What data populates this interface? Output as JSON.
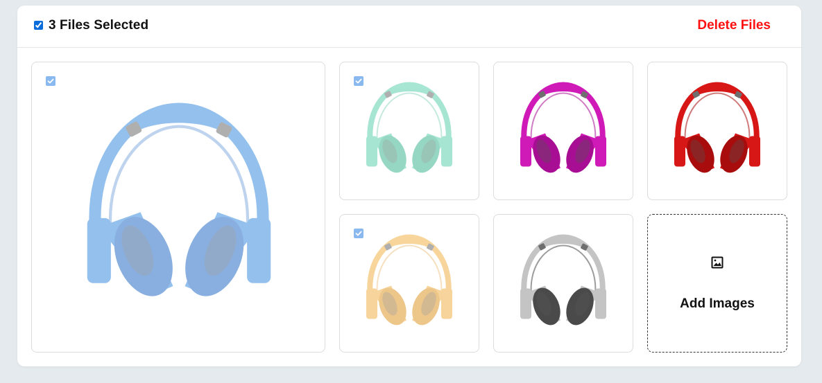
{
  "header": {
    "selected_text": "3 Files Selected",
    "select_all_checked": true,
    "delete_label": "Delete Files"
  },
  "colors": {
    "accent": "#0a6cdc",
    "delete": "#ff1010",
    "checkbox_faded": "#8ab9ef"
  },
  "images": [
    {
      "name": "blue-headphones",
      "color": "#3d8de0",
      "dark": "#2a6fc8",
      "selected": true
    },
    {
      "name": "green-headphones",
      "color": "#5ed1ad",
      "dark": "#3fb892",
      "selected": true
    },
    {
      "name": "magenta-headphones",
      "color": "#d01ab8",
      "dark": "#a70e93",
      "selected": false
    },
    {
      "name": "red-headphones",
      "color": "#d71616",
      "dark": "#a80c0c",
      "selected": false
    },
    {
      "name": "yellow-headphones",
      "color": "#f2b24a",
      "dark": "#e0982c",
      "selected": true
    },
    {
      "name": "silver-headphones",
      "color": "#c4c4c4",
      "dark": "#4a4a4a",
      "selected": false
    }
  ],
  "add_tile": {
    "label": "Add Images",
    "icon": "image-icon"
  }
}
